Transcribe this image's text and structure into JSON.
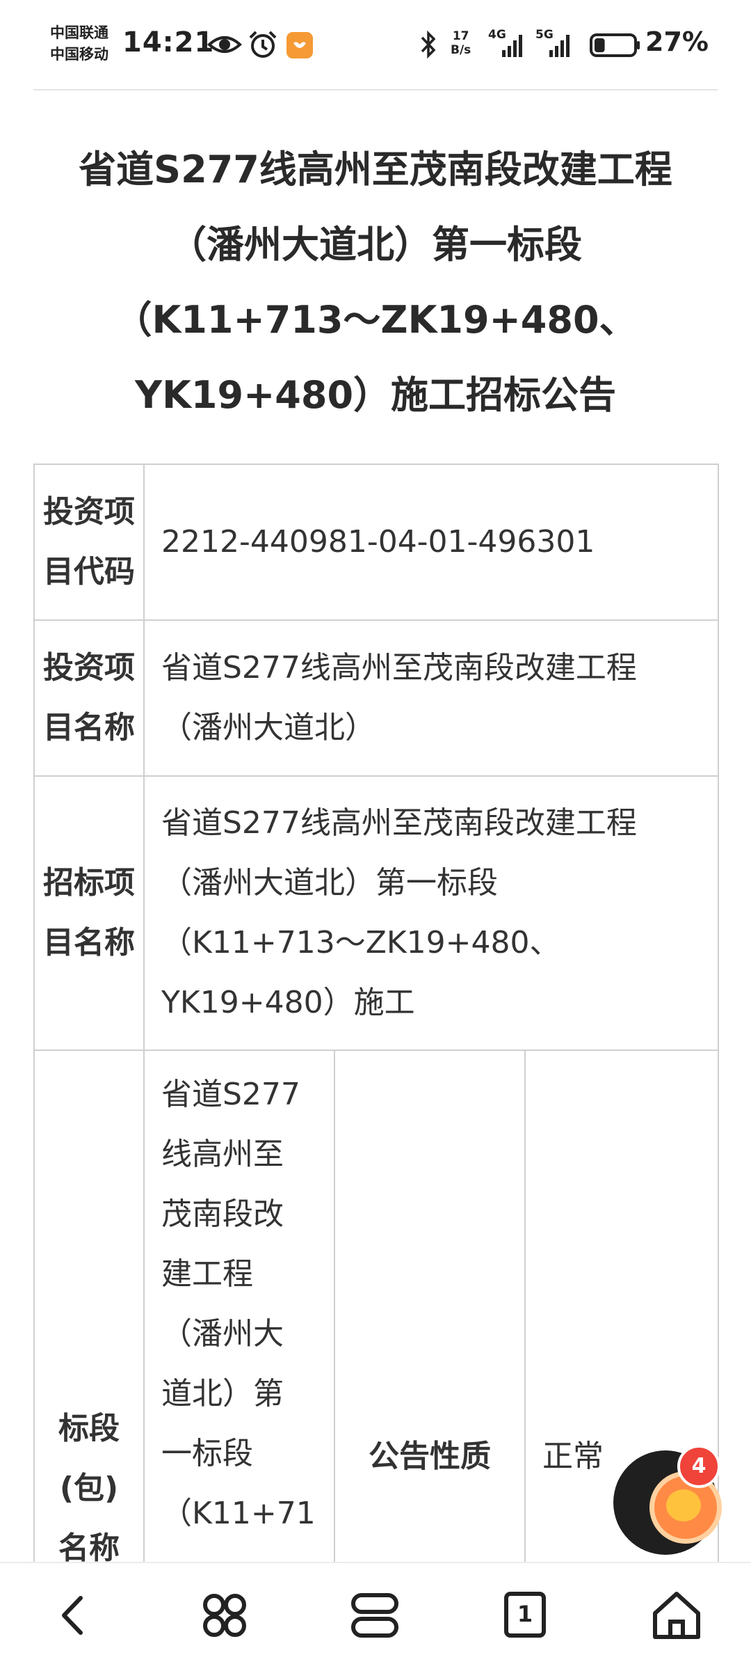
{
  "status_bar": {
    "carrier_1": "中国联通",
    "carrier_2": "中国移动",
    "time": "14:21",
    "net_speed_value": "17",
    "net_speed_unit": "B/s",
    "signal_1": "4G",
    "signal_2": "5G",
    "battery": "27%",
    "battery_level": 0.27
  },
  "title": {
    "line1": "省道S277线高州至茂南段改建工程",
    "line2": "（潘州大道北）第一标段",
    "line3": "（K11+713～ZK19+480、",
    "line4": "YK19+480）施工招标公告"
  },
  "table": {
    "row1_label_a": "投资项",
    "row1_label_b": "目代码",
    "row1_value": "2212-440981-04-01-496301",
    "row2_label_a": "投资项",
    "row2_label_b": "目名称",
    "row2_value_l1": "省道S277线高州至茂南段改建工程",
    "row2_value_l2": "（潘州大道北）",
    "row3_label_a": "招标项",
    "row3_label_b": "目名称",
    "row3_value_l1": "省道S277线高州至茂南段改建工程",
    "row3_value_l2": "（潘州大道北）第一标段",
    "row3_value_l3": "（K11+713～ZK19+480、",
    "row3_value_l4": "YK19+480）施工",
    "row4_label_a": "标段",
    "row4_label_b": "(包)",
    "row4_label_c": "名称",
    "row4_value": [
      "省道S277",
      "线高州至",
      "茂南段改",
      "建工程",
      "（潘州大",
      "道北）第",
      "一标段",
      "（K11+71"
    ],
    "row4_prop_label": "公告性质",
    "row4_prop_value": "正常"
  },
  "floating_widget": {
    "badge_count": "4"
  },
  "nav": {
    "page_count": "1"
  },
  "colors": {
    "badge": "#f0433a",
    "widget_orange": "#ff8a45",
    "battery_fill": "#222222"
  }
}
